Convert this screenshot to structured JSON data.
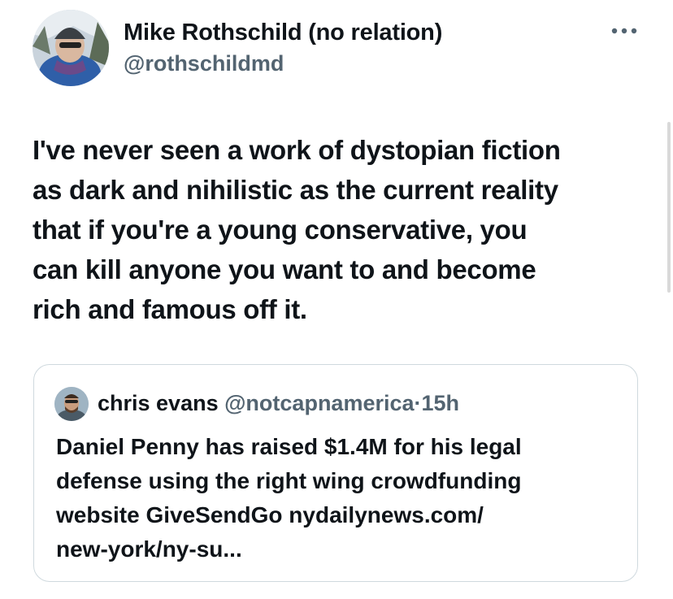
{
  "tweet": {
    "author": {
      "display_name": "Mike Rothschild (no relation)",
      "handle": "@rothschildmd",
      "avatar": "avatar-photo"
    },
    "more_icon": "more-horizontal-icon",
    "text_lines": [
      "I've never seen a work of dystopian fiction",
      "as dark and nihilistic as the current reality",
      "that if you're a young conservative, you",
      "can kill anyone you want to and become",
      "rich and famous off it."
    ]
  },
  "quote": {
    "author": {
      "display_name": "chris evans",
      "handle": "@notcapnamerica",
      "separator": "·",
      "time": "15h",
      "avatar": "avatar-photo"
    },
    "text_lines": [
      "Daniel Penny has raised $1.4M for his legal",
      "defense using the right wing crowdfunding",
      "website GiveSendGo nydailynews.com/",
      "new-york/ny-su..."
    ]
  },
  "colors": {
    "text_primary": "#0f1419",
    "text_secondary": "#536471",
    "border": "#cfd9de",
    "background": "#ffffff"
  }
}
